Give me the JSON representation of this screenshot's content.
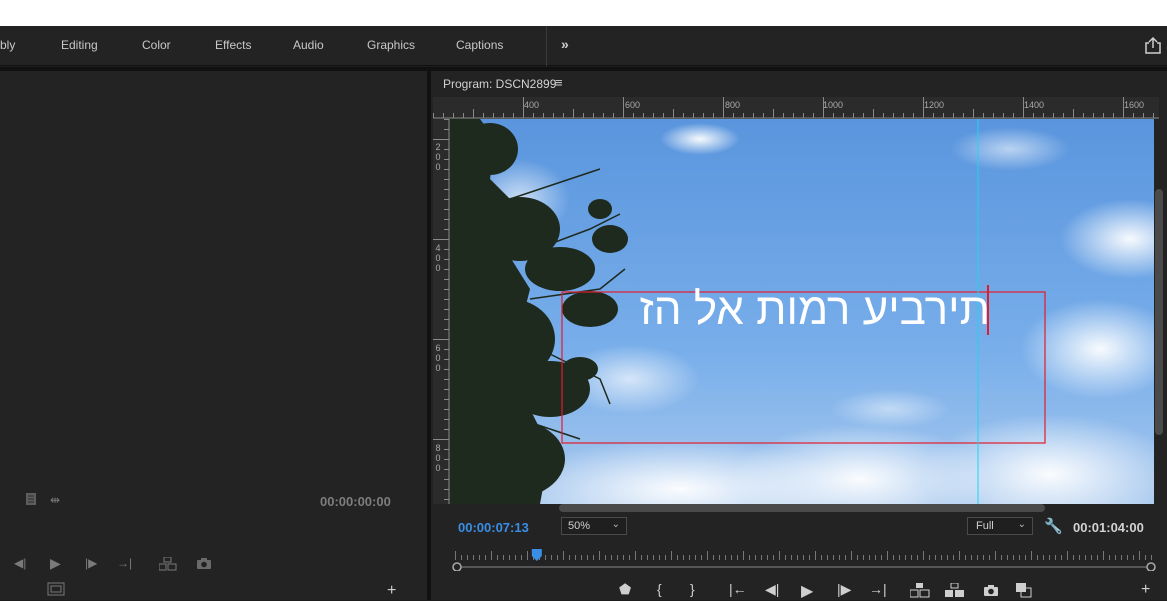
{
  "workspace": {
    "tabs": [
      "bly",
      "Editing",
      "Color",
      "Effects",
      "Audio",
      "Graphics",
      "Captions"
    ],
    "more_icon": "double-chevron-right-icon",
    "share_icon": "share-icon"
  },
  "source": {
    "timecode": "00:00:00:00"
  },
  "program": {
    "title": "Program: DSCN2899",
    "ruler_top": [
      "400",
      "600",
      "800",
      "1000",
      "1200",
      "1400",
      "1600"
    ],
    "ruler_left": [
      "200",
      "400",
      "600",
      "800"
    ],
    "overlay_text": "תירביע רמות אל הז",
    "current_timecode": "00:00:07:13",
    "zoom": "50%",
    "resolution": "Full",
    "duration": "00:01:04:00",
    "playhead_fraction": 0.115
  },
  "colors": {
    "accent_blue": "#3a8ee6",
    "guide_cyan": "#22d3ee",
    "text_box_red": "#e21c2c",
    "sky": "#6ea4e3"
  }
}
